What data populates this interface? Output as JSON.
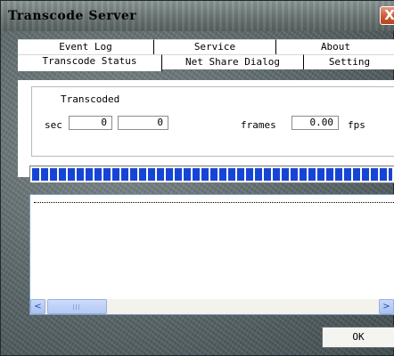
{
  "window": {
    "title": "Transcode Server",
    "close_symbol": "X"
  },
  "tabs": {
    "back_row": [
      "Event Log",
      "Service",
      "About"
    ],
    "front_row": [
      "Transcode Status",
      "Net Share Dialog",
      "Setting"
    ],
    "active": "Transcode Status"
  },
  "status": {
    "group_label": "Transcoded",
    "sec_label": "sec",
    "sec_value_1": "0",
    "sec_value_2": "0",
    "frames_label": "frames",
    "fps_value": "0.00",
    "fps_label": "fps",
    "progress_percent": 100
  },
  "list": {
    "scroll_left": "<",
    "scroll_right": ">"
  },
  "buttons": {
    "ok_label": "OK"
  },
  "colors": {
    "progress_block": "#1645d6",
    "close_button": "#c85631"
  }
}
